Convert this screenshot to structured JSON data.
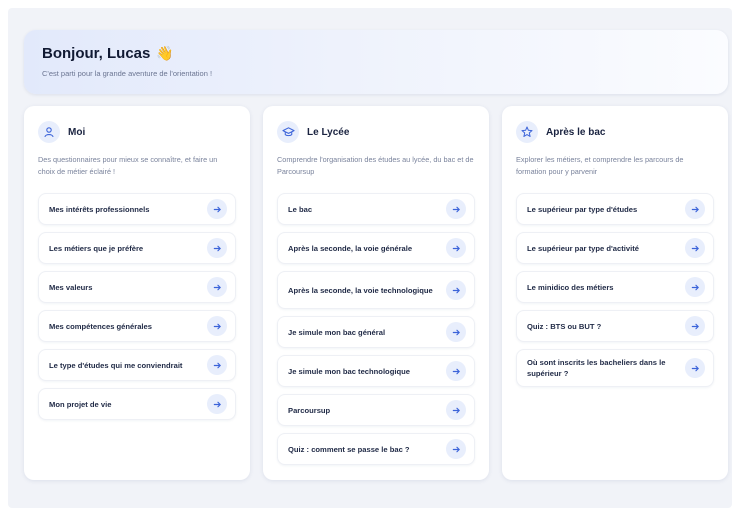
{
  "hero": {
    "title": "Bonjour, Lucas",
    "subtitle": "C'est parti pour la grande aventure de l'orientation !",
    "emoji": "👋"
  },
  "colors": {
    "accent": "#3b63d9",
    "icon_bg": "#e8eefc"
  },
  "cards": [
    {
      "icon": "user-icon",
      "title": "Moi",
      "description": "Des questionnaires pour mieux se connaître, et faire un choix de métier éclairé !",
      "items": [
        {
          "label": "Mes intérêts professionnels"
        },
        {
          "label": "Les métiers que je préfère"
        },
        {
          "label": "Mes valeurs"
        },
        {
          "label": "Mes compétences générales"
        },
        {
          "label": "Le type d'études qui me conviendrait"
        },
        {
          "label": "Mon projet de vie"
        }
      ]
    },
    {
      "icon": "graduation-cap-icon",
      "title": "Le Lycée",
      "description": "Comprendre l'organisation des études au lycée, du bac et de Parcoursup",
      "items": [
        {
          "label": "Le bac"
        },
        {
          "label": "Après la seconde, la voie générale"
        },
        {
          "label": "Après la seconde, la voie technologique"
        },
        {
          "label": "Je simule mon bac général"
        },
        {
          "label": "Je simule mon bac technologique"
        },
        {
          "label": "Parcoursup"
        },
        {
          "label": "Quiz : comment se passe le bac ?"
        }
      ]
    },
    {
      "icon": "star-icon",
      "title": "Après le bac",
      "description": "Explorer les métiers, et comprendre les parcours de formation pour y parvenir",
      "items": [
        {
          "label": "Le supérieur par type d'études"
        },
        {
          "label": "Le supérieur par type d'activité"
        },
        {
          "label": "Le minidico des métiers"
        },
        {
          "label": "Quiz : BTS ou BUT ?"
        },
        {
          "label": "Où sont inscrits les bacheliers dans le supérieur ?"
        }
      ]
    }
  ]
}
